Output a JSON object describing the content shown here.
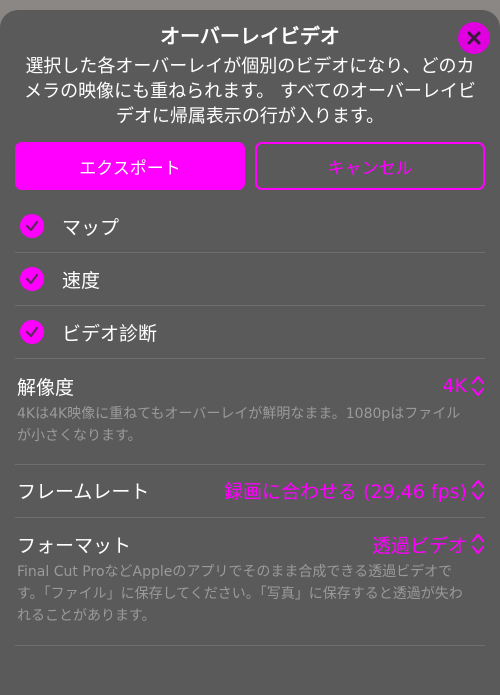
{
  "dialog": {
    "title": "オーバーレイビデオ",
    "description": "選択した各オーバーレイが個別のビデオになり、どのカメラの映像にも重ねられます。 すべてのオーバーレイビデオに帰属表示の行が入ります。",
    "close_icon": "close-icon"
  },
  "buttons": {
    "export_label": "エクスポート",
    "cancel_label": "キャンセル"
  },
  "overlays": [
    {
      "label": "マップ",
      "checked": true
    },
    {
      "label": "速度",
      "checked": true
    },
    {
      "label": "ビデオ診断",
      "checked": true
    }
  ],
  "settings": {
    "resolution": {
      "name": "解像度",
      "value": "4K",
      "note": "4Kは4K映像に重ねてもオーバーレイが鮮明なまま。1080pはファイルが小さくなります。"
    },
    "framerate": {
      "name": "フレームレート",
      "value": "録画に合わせる (29,46 fps)"
    },
    "format": {
      "name": "フォーマット",
      "value": "透過ビデオ",
      "note": "Final Cut ProなどAppleのアプリでそのまま合成できる透過ビデオです。「ファイル」に保存してください。「写真」に保存すると透過が失われることがあります。"
    }
  },
  "colors": {
    "accent": "#ff00ff",
    "sheet": "#5a5a5a"
  }
}
